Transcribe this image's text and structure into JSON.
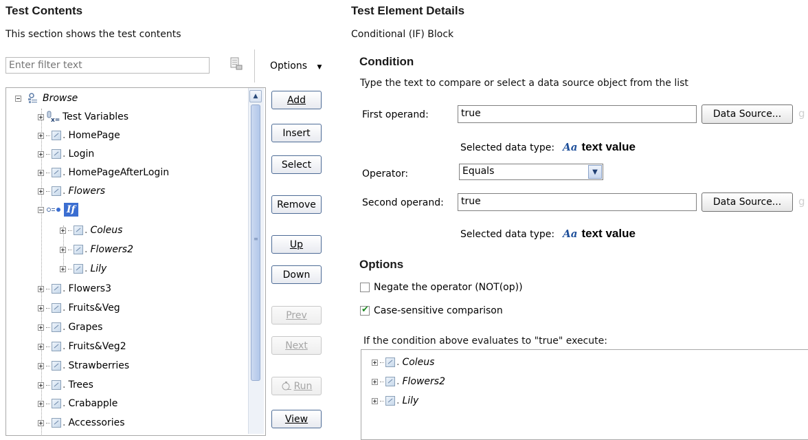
{
  "left": {
    "title": "Test Contents",
    "description": "This section shows the test contents",
    "filter_placeholder": "Enter filter text",
    "options_label": "Options",
    "tree": {
      "root": "Browse",
      "items": [
        {
          "label": "Test Variables"
        },
        {
          "label": "HomePage"
        },
        {
          "label": "Login"
        },
        {
          "label": "HomePageAfterLogin"
        },
        {
          "label": "Flowers"
        },
        {
          "label": "If"
        },
        {
          "label": "Coleus"
        },
        {
          "label": "Flowers2"
        },
        {
          "label": "Lily"
        },
        {
          "label": "Flowers3"
        },
        {
          "label": "Fruits&Veg"
        },
        {
          "label": "Grapes"
        },
        {
          "label": "Fruits&Veg2"
        },
        {
          "label": "Strawberries"
        },
        {
          "label": "Trees"
        },
        {
          "label": "Crabapple"
        },
        {
          "label": "Accessories"
        }
      ]
    },
    "buttons": {
      "add": "Add",
      "insert": "Insert",
      "select": "Select",
      "remove": "Remove",
      "up": "Up",
      "down": "Down",
      "prev": "Prev",
      "next": "Next",
      "run": "Run",
      "view": "View"
    }
  },
  "right": {
    "title": "Test Element Details",
    "element_type": "Conditional (IF) Block",
    "condition": {
      "heading": "Condition",
      "instruction": "Type the text to compare or select a data source object from the list",
      "first_operand_label": "First operand:",
      "first_operand_value": "true",
      "data_source_label": "Data Source...",
      "selected_type_label": "Selected data type:",
      "type_icon": "Aa",
      "type_value": "text value",
      "operator_label": "Operator:",
      "operator_value": "Equals",
      "second_operand_label": "Second operand:",
      "second_operand_value": "true"
    },
    "options": {
      "heading": "Options",
      "negate_label": "Negate the operator (NOT(op))",
      "negate_checked": false,
      "case_label": "Case-sensitive comparison",
      "case_checked": true,
      "execute_label": "If the condition above evaluates to \"true\" execute:",
      "execute_items": [
        {
          "label": "Coleus"
        },
        {
          "label": "Flowers2"
        },
        {
          "label": "Lily"
        }
      ]
    }
  }
}
